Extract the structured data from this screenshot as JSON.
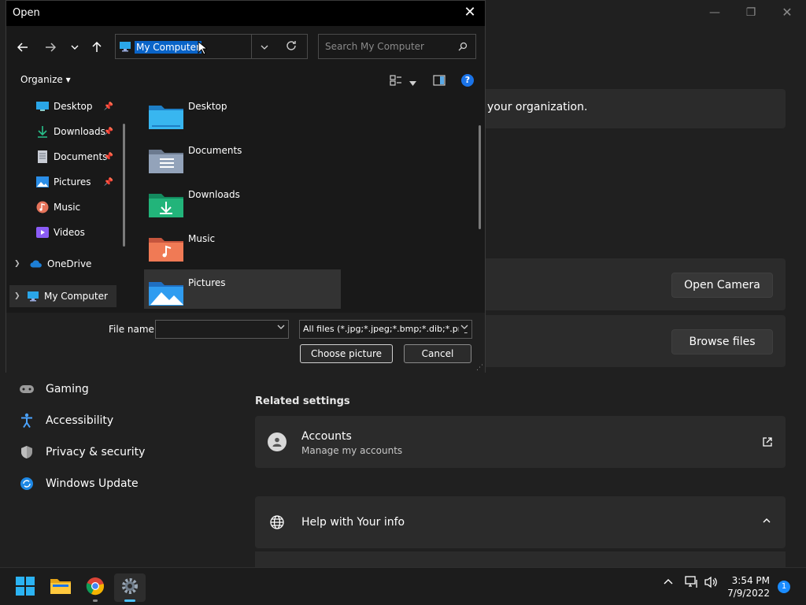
{
  "settings": {
    "org_text": "your organization.",
    "open_camera": "Open Camera",
    "browse_files": "Browse files",
    "related_settings": "Related settings",
    "accounts_title": "Accounts",
    "accounts_sub": "Manage my accounts",
    "help_title": "Help with Your info",
    "nav": [
      {
        "label": "Gaming",
        "icon": "gamepad-icon"
      },
      {
        "label": "Accessibility",
        "icon": "accessibility-icon"
      },
      {
        "label": "Privacy & security",
        "icon": "shield-icon"
      },
      {
        "label": "Windows Update",
        "icon": "update-icon"
      }
    ]
  },
  "dialog": {
    "title": "Open",
    "address": "My Computer",
    "search_placeholder": "Search My Computer",
    "organize": "Organize ▾",
    "sidebar": [
      {
        "label": "Desktop",
        "pinned": true
      },
      {
        "label": "Downloads",
        "pinned": true
      },
      {
        "label": "Documents",
        "pinned": true
      },
      {
        "label": "Pictures",
        "pinned": true
      },
      {
        "label": "Music",
        "pinned": false
      },
      {
        "label": "Videos",
        "pinned": false
      },
      {
        "label": "OneDrive",
        "pinned": false
      },
      {
        "label": "My Computer",
        "pinned": false
      }
    ],
    "files": [
      "Desktop",
      "Documents",
      "Downloads",
      "Music",
      "Pictures"
    ],
    "file_name_label": "File name:",
    "file_name_value": "",
    "filter": "All files (*.jpg;*.jpeg;*.bmp;*.dib;*.png",
    "choose_btn": "Choose picture",
    "cancel_btn": "Cancel"
  },
  "taskbar": {
    "time": "3:54 PM",
    "date": "7/9/2022",
    "notifications": "1"
  }
}
